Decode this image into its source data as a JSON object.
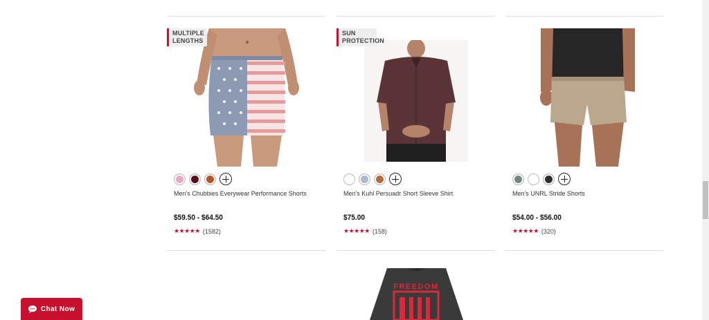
{
  "products": [
    {
      "name": "Men's Chubbies Everywear Performance Shorts",
      "price": "$59.50 - $64.50",
      "rating_count": "(1582)",
      "badge": "MULTIPLE LENGTHS",
      "swatches": [
        "#e7a9c3",
        "#5a0d16",
        "#b5532a"
      ]
    },
    {
      "name": "Men's Kuhl Persuadr Short Sleeve Shirt",
      "price": "$75.00",
      "rating_count": "(158)",
      "badge": "SUN PROTECTION",
      "swatches": [
        "#ffffff",
        "#a8b9d0",
        "#b46a3a"
      ]
    },
    {
      "name": "Men's UNRL Stride Shorts",
      "price": "$54.00 - $56.00",
      "rating_count": "(320)",
      "badge": "",
      "swatches": [
        "#6e8a7e",
        "#ffffff",
        "#2e2e2e"
      ]
    }
  ],
  "stars": "★★★★★",
  "next_row_shirt_text": "FREEDOM",
  "chat": {
    "label": "Chat Now"
  },
  "colors": {
    "accent": "#c8102e"
  }
}
